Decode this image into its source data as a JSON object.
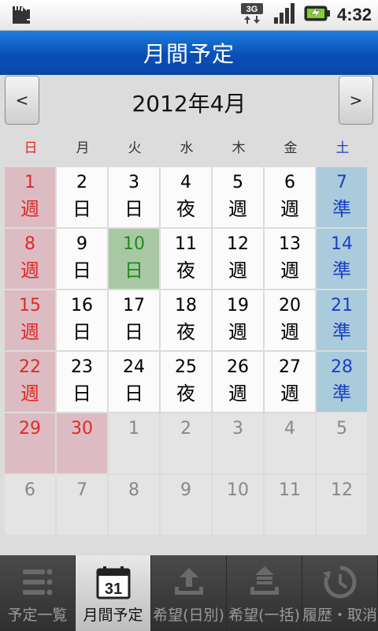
{
  "status_bar": {
    "time": "4:32",
    "network": "3G",
    "icons": [
      "sd-card-alert-icon",
      "3g-icon",
      "signal-icon",
      "battery-charging-icon"
    ]
  },
  "header": {
    "title": "月間予定"
  },
  "month_nav": {
    "prev_label": "<",
    "next_label": ">",
    "month_title": "2012年4月"
  },
  "weekdays": [
    "日",
    "月",
    "火",
    "水",
    "木",
    "金",
    "土"
  ],
  "calendar": {
    "weeks": [
      [
        {
          "d": "1",
          "s": "週"
        },
        {
          "d": "2",
          "s": "日"
        },
        {
          "d": "3",
          "s": "日"
        },
        {
          "d": "4",
          "s": "夜"
        },
        {
          "d": "5",
          "s": "週"
        },
        {
          "d": "6",
          "s": "週"
        },
        {
          "d": "7",
          "s": "準"
        }
      ],
      [
        {
          "d": "8",
          "s": "週"
        },
        {
          "d": "9",
          "s": "日"
        },
        {
          "d": "10",
          "s": "日"
        },
        {
          "d": "11",
          "s": "夜"
        },
        {
          "d": "12",
          "s": "週"
        },
        {
          "d": "13",
          "s": "週"
        },
        {
          "d": "14",
          "s": "準"
        }
      ],
      [
        {
          "d": "15",
          "s": "週"
        },
        {
          "d": "16",
          "s": "日"
        },
        {
          "d": "17",
          "s": "日"
        },
        {
          "d": "18",
          "s": "夜"
        },
        {
          "d": "19",
          "s": "週"
        },
        {
          "d": "20",
          "s": "週"
        },
        {
          "d": "21",
          "s": "準"
        }
      ],
      [
        {
          "d": "22",
          "s": "週"
        },
        {
          "d": "23",
          "s": "日"
        },
        {
          "d": "24",
          "s": "日"
        },
        {
          "d": "25",
          "s": "夜"
        },
        {
          "d": "26",
          "s": "週"
        },
        {
          "d": "27",
          "s": "週"
        },
        {
          "d": "28",
          "s": "準"
        }
      ],
      [
        {
          "d": "29",
          "s": ""
        },
        {
          "d": "30",
          "s": ""
        },
        {
          "d": "1",
          "s": ""
        },
        {
          "d": "2",
          "s": ""
        },
        {
          "d": "3",
          "s": ""
        },
        {
          "d": "4",
          "s": ""
        },
        {
          "d": "5",
          "s": ""
        }
      ],
      [
        {
          "d": "6",
          "s": ""
        },
        {
          "d": "7",
          "s": ""
        },
        {
          "d": "8",
          "s": ""
        },
        {
          "d": "9",
          "s": ""
        },
        {
          "d": "10",
          "s": ""
        },
        {
          "d": "11",
          "s": ""
        },
        {
          "d": "12",
          "s": ""
        }
      ]
    ],
    "today": "10"
  },
  "colors": {
    "sunday": "#e02828",
    "saturday": "#1a3fc7",
    "today": "#1d8a1d",
    "header_blue": "#0a4fb5"
  },
  "bottom_nav": {
    "tabs": [
      {
        "label": "予定一覧",
        "icon": "list-icon",
        "active": false
      },
      {
        "label": "月間予定",
        "icon": "calendar-icon",
        "active": true
      },
      {
        "label": "希望(日別)",
        "icon": "upload-icon",
        "active": false
      },
      {
        "label": "希望(一括)",
        "icon": "upload-all-icon",
        "active": false
      },
      {
        "label": "履歴・取消",
        "icon": "history-icon",
        "active": false
      }
    ]
  }
}
